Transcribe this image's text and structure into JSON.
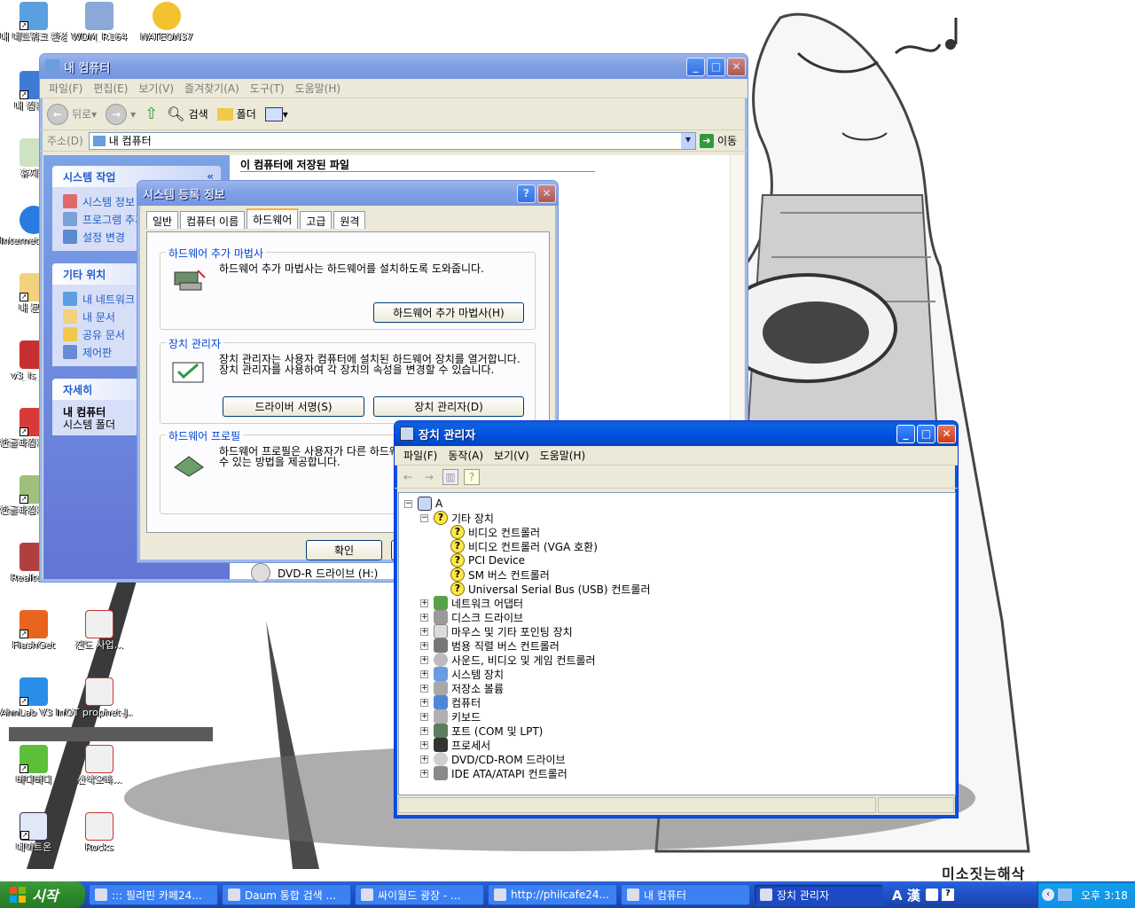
{
  "desktop": {
    "icons": [
      {
        "label": "내 네트워크 환경"
      },
      {
        "label": "WDM_R164"
      },
      {
        "label": "NATEON37"
      },
      {
        "label": "내 컴퓨터"
      },
      {
        "label": "휴지통"
      },
      {
        "label": "Internet Explorer"
      },
      {
        "label": "내 문서"
      },
      {
        "label": "v3_is_2..."
      },
      {
        "label": "한글과컴퓨터 한글 2..."
      },
      {
        "label": "한글과컴퓨터 사전"
      },
      {
        "label": "Realtek..."
      },
      {
        "label": "FlashGet"
      },
      {
        "label": "전도 사업..."
      },
      {
        "label": "AhnLab V3 Internet S..."
      },
      {
        "label": "OT prophet-J..."
      },
      {
        "label": "버디버디"
      },
      {
        "label": "신석오빠..."
      },
      {
        "label": "네이트온"
      },
      {
        "label": "Rocks"
      }
    ],
    "wallpaper_caption": "미소짓는해삭"
  },
  "mycomputer": {
    "title": "내 컴퓨터",
    "menu": [
      "파일(F)",
      "편집(E)",
      "보기(V)",
      "즐겨찾기(A)",
      "도구(T)",
      "도움말(H)"
    ],
    "toolbar": {
      "back": "뒤로",
      "search": "검색",
      "folders": "폴더"
    },
    "address_label": "주소(D)",
    "address_value": "내 컴퓨터",
    "go_label": "이동",
    "section_header": "이 컴퓨터에 저장된 파일",
    "dvd_label": "DVD-R 드라이브 (H:)",
    "tasks_panel": {
      "title": "시스템 작업",
      "items": [
        "시스템 정보 보기",
        "프로그램 추가/제거",
        "설정 변경"
      ]
    },
    "places_panel": {
      "title": "기타 위치",
      "items": [
        "내 네트워크 환경",
        "내 문서",
        "공유 문서",
        "제어판"
      ]
    },
    "details_panel": {
      "title": "자세히",
      "name": "내 컴퓨터",
      "type": "시스템 폴더"
    }
  },
  "sysprop": {
    "title": "시스템 등록 정보",
    "tabs": [
      "일반",
      "컴퓨터 이름",
      "하드웨어",
      "고급",
      "원격"
    ],
    "active_tab": "하드웨어",
    "wizard": {
      "title": "하드웨어 추가 마법사",
      "desc": "하드웨어 추가 마법사는 하드웨어를 설치하도록 도와줍니다.",
      "button": "하드웨어 추가 마법사(H)"
    },
    "devmgr_group": {
      "title": "장치 관리자",
      "desc": "장치 관리자는 사용자 컴퓨터에 설치된 하드웨어 장치를 열거합니다. 장치 관리자를 사용하여 각 장치의 속성을 변경할 수 있습니다.",
      "button_driver": "드라이버 서명(S)",
      "button_devmgr": "장치 관리자(D)"
    },
    "profile_group": {
      "title": "하드웨어 프로필",
      "desc": "하드웨어 프로필은 사용자가 다른 하드웨어 구성을 설정하고 저장할 수 있는 방법을 제공합니다."
    },
    "ok_button": "확인"
  },
  "devmgr": {
    "title": "장치 관리자",
    "menu": [
      "파일(F)",
      "동작(A)",
      "보기(V)",
      "도움말(H)"
    ],
    "root": "A",
    "other_devices": {
      "label": "기타 장치",
      "children": [
        "비디오 컨트롤러",
        "비디오 컨트롤러 (VGA 호환)",
        "PCI Device",
        "SM 버스 컨트롤러",
        "Universal Serial Bus (USB) 컨트롤러"
      ]
    },
    "categories": [
      "네트워크 어댑터",
      "디스크 드라이브",
      "마우스 및 기타 포인팅 장치",
      "범용 직렬 버스 컨트롤러",
      "사운드, 비디오 및 게임 컨트롤러",
      "시스템 장치",
      "저장소 볼륨",
      "컴퓨터",
      "키보드",
      "포트 (COM 및 LPT)",
      "프로세서",
      "DVD/CD-ROM 드라이브",
      "IDE ATA/ATAPI 컨트롤러"
    ]
  },
  "taskbar": {
    "start_label": "시작",
    "tasks": [
      "::: 필리핀 카페24...",
      "Daum 통합 검색 ...",
      "싸이월드 광장 - ...",
      "http://philcafe24...",
      "내 컴퓨터",
      "장치 관리자"
    ],
    "active_task": "장치 관리자",
    "lang_indicator": "A 漢",
    "clock": "오후 3:18"
  },
  "colors": {
    "xp_blue": "#0054e3",
    "start_green": "#2c8a2c",
    "link_blue": "#215dc6",
    "group_title": "#0046d5"
  }
}
